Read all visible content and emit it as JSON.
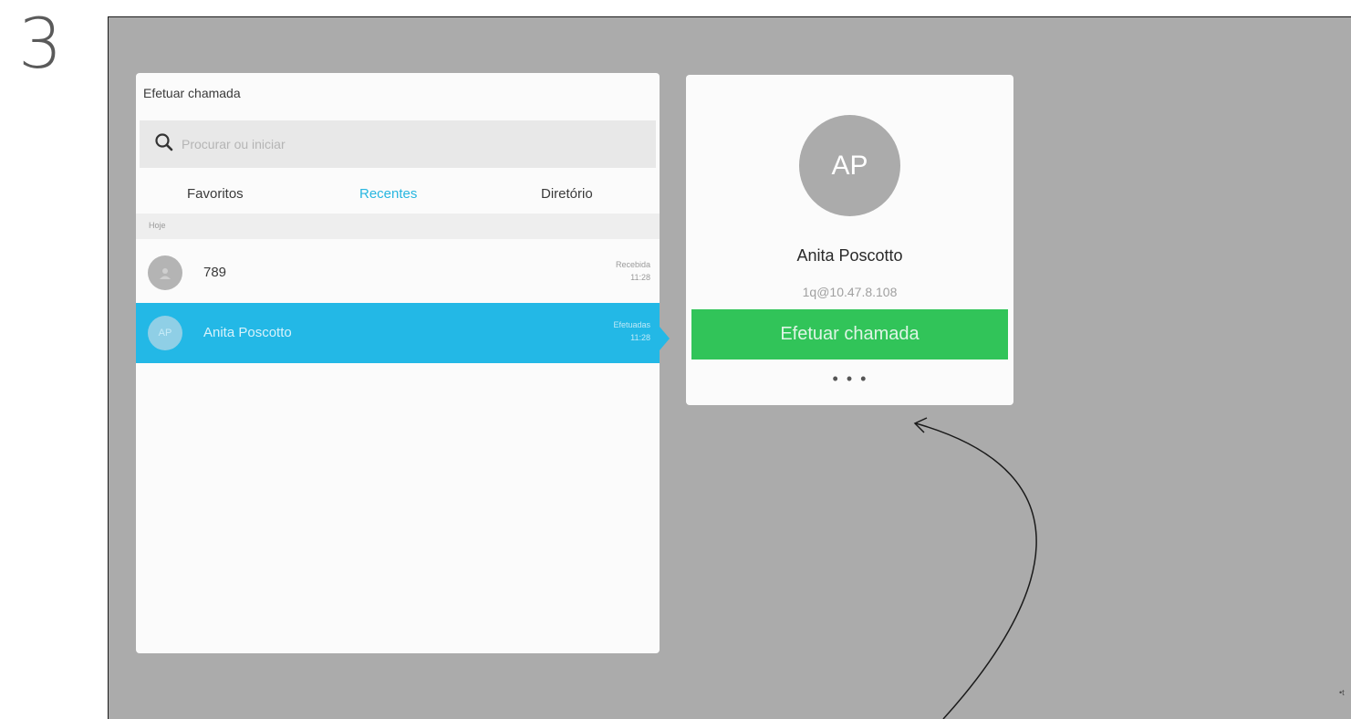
{
  "step": "3",
  "panel": {
    "title": "Efetuar chamada",
    "search": {
      "placeholder": "Procurar ou iniciar"
    },
    "tabs": [
      {
        "label": "Favoritos",
        "active": false
      },
      {
        "label": "Recentes",
        "active": true
      },
      {
        "label": "Diretório",
        "active": false
      }
    ],
    "section": "Hoje",
    "rows": [
      {
        "name": "789",
        "status": "Recebida",
        "time": "11:28",
        "avatar": "",
        "selected": false
      },
      {
        "name": "Anita Poscotto",
        "status": "Efetuadas",
        "time": "11:28",
        "avatar": "AP",
        "selected": true
      }
    ]
  },
  "card": {
    "initials": "AP",
    "name": "Anita Poscotto",
    "address": "1q@10.47.8.108",
    "call_button": "Efetuar chamada",
    "more": "• • •"
  },
  "corner": "•t",
  "colors": {
    "background": "#ababab",
    "accent": "#23b8e6",
    "call_green": "#31c459",
    "avatar_gray": "#ababab"
  },
  "icons": [
    "search-icon",
    "more-icon",
    "arrow-annotation"
  ]
}
